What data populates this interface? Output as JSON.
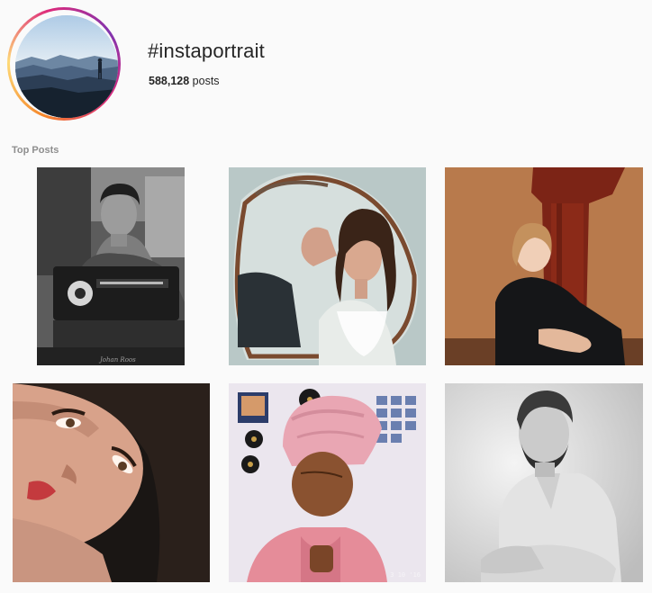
{
  "hashtag": {
    "title": "#instaportrait",
    "post_count": "588,128",
    "post_count_suffix": " posts"
  },
  "section": {
    "label": "Top Posts"
  },
  "posts": [
    {
      "subject": "woman at sewing machine, black and white",
      "signature": "Johan Roos"
    },
    {
      "subject": "woman reflected in round mirror"
    },
    {
      "subject": "woman hugging red wooden pillar"
    },
    {
      "subject": "close-up of woman looking up"
    },
    {
      "subject": "girl with pink towel on head",
      "stamp": "3 10 '16"
    },
    {
      "subject": "bearded man with arms crossed, black and white"
    }
  ],
  "colors": {
    "background": "#fafafa",
    "text": "#262626",
    "muted": "#8e8e8e",
    "ring_gradient": [
      "#f58529",
      "#feda77",
      "#dd2a7b",
      "#8134af"
    ]
  }
}
